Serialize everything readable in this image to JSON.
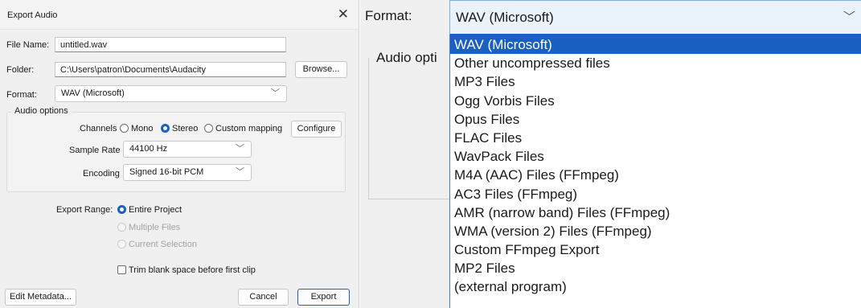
{
  "dialog": {
    "title": "Export Audio",
    "close_glyph": "✕",
    "file_name_label": "File Name:",
    "file_name_value": "untitled.wav",
    "folder_label": "Folder:",
    "folder_value": "C:\\Users\\patron\\Documents\\Audacity",
    "browse_label": "Browse...",
    "format_label": "Format:",
    "format_value": "WAV (Microsoft)",
    "audio_options": {
      "title": "Audio options",
      "channels_label": "Channels",
      "channels": [
        {
          "label": "Mono",
          "checked": false
        },
        {
          "label": "Stereo",
          "checked": true
        },
        {
          "label": "Custom mapping",
          "checked": false
        }
      ],
      "configure_label": "Configure",
      "sample_rate_label": "Sample Rate",
      "sample_rate_value": "44100 Hz",
      "encoding_label": "Encoding",
      "encoding_value": "Signed 16-bit PCM"
    },
    "export_range": {
      "label": "Export Range:",
      "options": [
        {
          "label": "Entire Project",
          "checked": true,
          "enabled": true
        },
        {
          "label": "Multiple Files",
          "checked": false,
          "enabled": false
        },
        {
          "label": "Current Selection",
          "checked": false,
          "enabled": false
        }
      ]
    },
    "trim_label": "Trim blank space before first clip",
    "edit_metadata_label": "Edit Metadata...",
    "cancel_label": "Cancel",
    "export_label": "Export"
  },
  "zoom": {
    "format_label": "Format:",
    "audio_options_label": "Audio opti",
    "selected_value": "WAV (Microsoft)",
    "options": [
      "WAV (Microsoft)",
      "Other uncompressed files",
      "MP3 Files",
      "Ogg Vorbis Files",
      "Opus Files",
      "FLAC Files",
      "WavPack Files",
      "M4A (AAC) Files (FFmpeg)",
      "AC3 Files (FFmpeg)",
      "AMR (narrow band) Files (FFmpeg)",
      "WMA (version 2) Files (FFmpeg)",
      "Custom FFmpeg Export",
      "MP2 Files",
      "(external program)"
    ],
    "selected_index": 0
  },
  "icons": {
    "close": "close-icon",
    "chevron": "chevron-down-icon",
    "radio": "radio-icon",
    "checkbox": "checkbox-icon"
  },
  "colors": {
    "accent": "#1a5fc2",
    "dialog_bg": "#f0f0f0",
    "selection_text": "#ffffff"
  }
}
